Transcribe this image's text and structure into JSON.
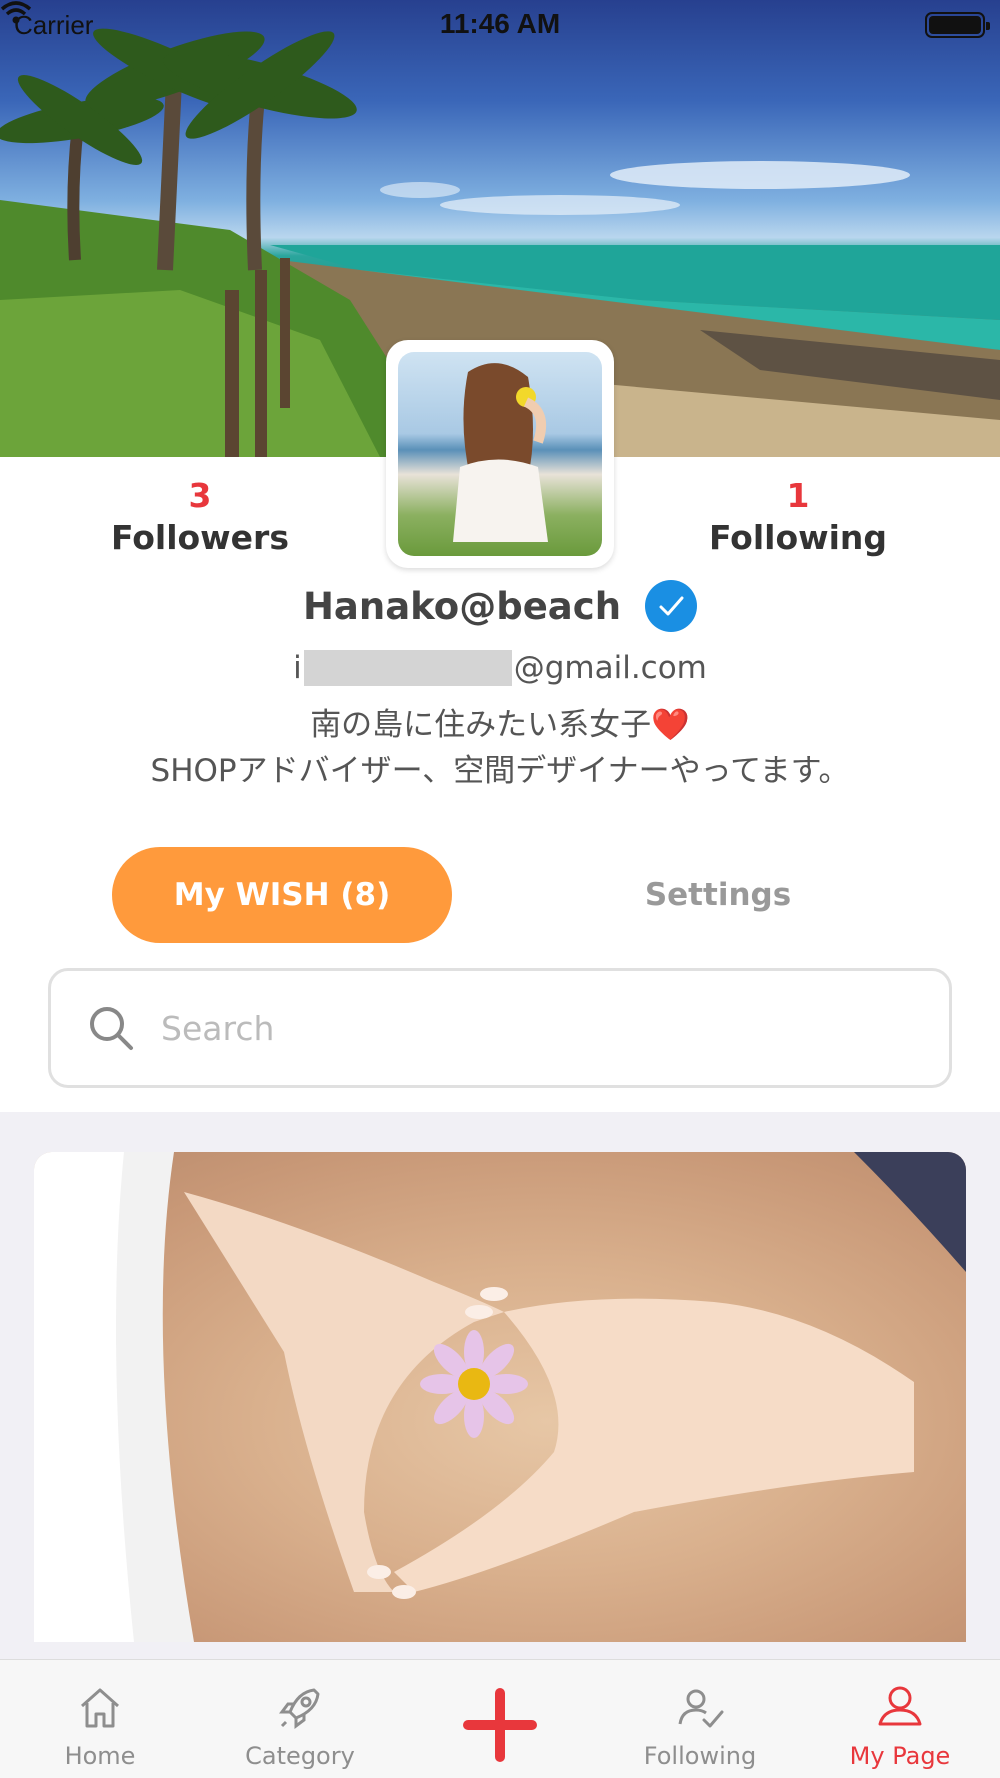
{
  "status_bar": {
    "carrier": "Carrier",
    "time": "11:46 AM"
  },
  "profile": {
    "followers_count": "3",
    "followers_label": "Followers",
    "following_count": "1",
    "following_label": "Following",
    "name": "Hanako@beach",
    "email_prefix": "i",
    "email_suffix": "@gmail.com",
    "bio_line1": "南の島に住みたい系女子❤️",
    "bio_line2": "SHOPアドバイザー、空間デザイナーやってます。"
  },
  "tabs": {
    "wish_label": "My WISH (8)",
    "settings_label": "Settings"
  },
  "search": {
    "placeholder": "Search"
  },
  "tab_bar": {
    "items": [
      {
        "label": "Home",
        "icon": "home-icon"
      },
      {
        "label": "Category",
        "icon": "rocket-icon"
      },
      {
        "label": "",
        "icon": "add-icon"
      },
      {
        "label": "Following",
        "icon": "user-check-icon"
      },
      {
        "label": "My Page",
        "icon": "user-icon"
      }
    ]
  },
  "colors": {
    "accent_red": "#e8373c",
    "accent_orange": "#ff9a3c",
    "verified_blue": "#1a8fe3"
  }
}
